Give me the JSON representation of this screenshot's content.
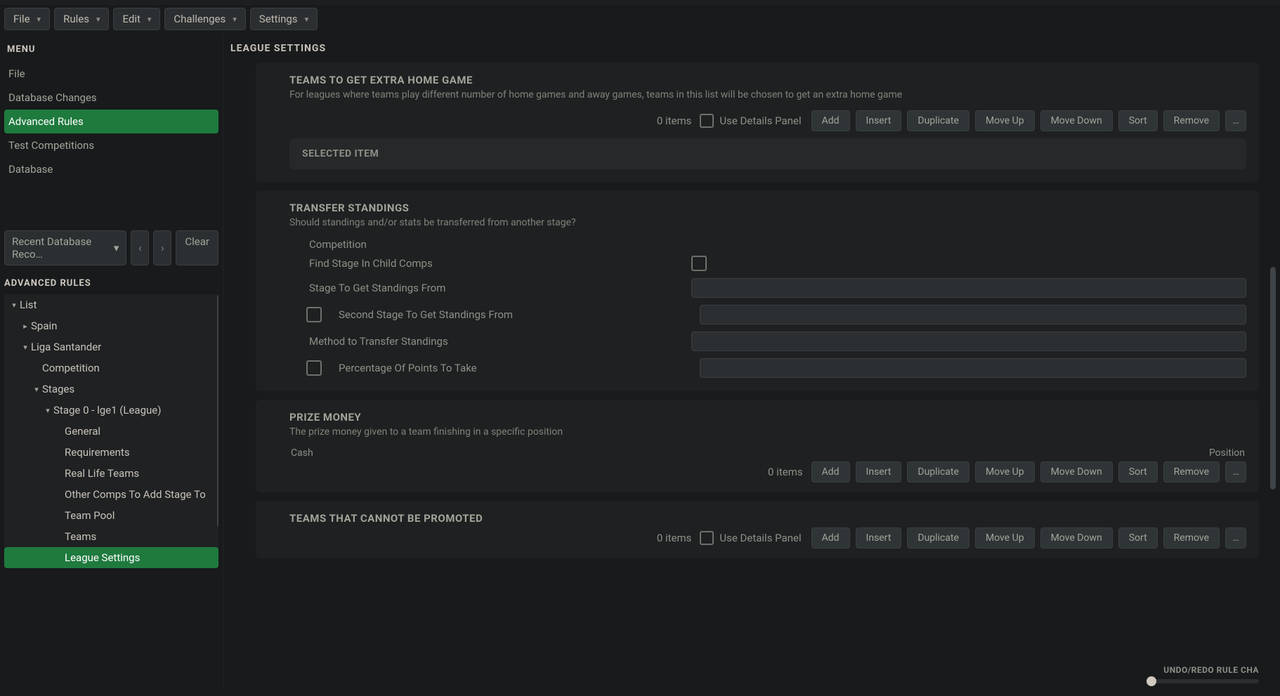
{
  "menubar": [
    {
      "label": "File"
    },
    {
      "label": "Rules"
    },
    {
      "label": "Edit"
    },
    {
      "label": "Challenges"
    },
    {
      "label": "Settings"
    }
  ],
  "sidebar": {
    "menu_heading": "MENU",
    "items": [
      {
        "label": "File"
      },
      {
        "label": "Database Changes"
      },
      {
        "label": "Advanced Rules",
        "selected": true
      },
      {
        "label": "Test Competitions"
      },
      {
        "label": "Database"
      }
    ],
    "recent": {
      "label": "Recent Database Reco…"
    },
    "clear": "Clear",
    "adv_heading": "ADVANCED RULES",
    "tree": [
      {
        "depth": 0,
        "twist": "▾",
        "label": "List"
      },
      {
        "depth": 1,
        "twist": "▸",
        "label": "Spain"
      },
      {
        "depth": 1,
        "twist": "▾",
        "label": "Liga Santander"
      },
      {
        "depth": 2,
        "twist": "",
        "label": "Competition"
      },
      {
        "depth": 2,
        "twist": "▾",
        "label": "Stages"
      },
      {
        "depth": 3,
        "twist": "▾",
        "label": "Stage 0 - lge1 (League)"
      },
      {
        "depth": 4,
        "twist": "",
        "label": "General"
      },
      {
        "depth": 4,
        "twist": "",
        "label": "Requirements"
      },
      {
        "depth": 4,
        "twist": "",
        "label": "Real Life Teams"
      },
      {
        "depth": 4,
        "twist": "",
        "label": "Other Comps To Add Stage To"
      },
      {
        "depth": 4,
        "twist": "",
        "label": "Team Pool"
      },
      {
        "depth": 4,
        "twist": "",
        "label": "Teams"
      },
      {
        "depth": 4,
        "twist": "",
        "label": "League Settings",
        "selected": true
      }
    ]
  },
  "main": {
    "title": "LEAGUE SETTINGS",
    "section_extra_home": {
      "heading": "TEAMS TO GET EXTRA HOME GAME",
      "desc": "For leagues where teams play different number of home games and away games, teams in this list will be chosen to get an extra home game",
      "items": "0 items",
      "use_details": "Use Details Panel",
      "buttons": [
        "Add",
        "Insert",
        "Duplicate",
        "Move Up",
        "Move Down",
        "Sort",
        "Remove"
      ],
      "selected_item": "SELECTED ITEM"
    },
    "section_transfer": {
      "heading": "TRANSFER STANDINGS",
      "desc": "Should standings and/or stats be transferred from another stage?",
      "comp_label": "Competition",
      "fields": [
        {
          "type": "chk",
          "label": "Find Stage In Child Comps"
        },
        {
          "type": "select",
          "label": "Stage To Get Standings From"
        },
        {
          "type": "chk_select",
          "label": "Second Stage To Get Standings From"
        },
        {
          "type": "select",
          "label": "Method to Transfer Standings"
        },
        {
          "type": "chk_select",
          "label": "Percentage Of Points To Take"
        }
      ]
    },
    "section_prize": {
      "heading": "PRIZE MONEY",
      "desc": "The prize money given to a team finishing in a specific position",
      "col_cash": "Cash",
      "col_position": "Position",
      "items": "0 items",
      "buttons": [
        "Add",
        "Insert",
        "Duplicate",
        "Move Up",
        "Move Down",
        "Sort",
        "Remove"
      ]
    },
    "section_cannot": {
      "heading": "TEAMS THAT CANNOT BE PROMOTED",
      "items": "0 items",
      "use_details": "Use Details Panel",
      "buttons": [
        "Add",
        "Insert",
        "Duplicate",
        "Move Up",
        "Move Down",
        "Sort",
        "Remove"
      ]
    },
    "undo": "UNDO/REDO RULE CHA"
  }
}
